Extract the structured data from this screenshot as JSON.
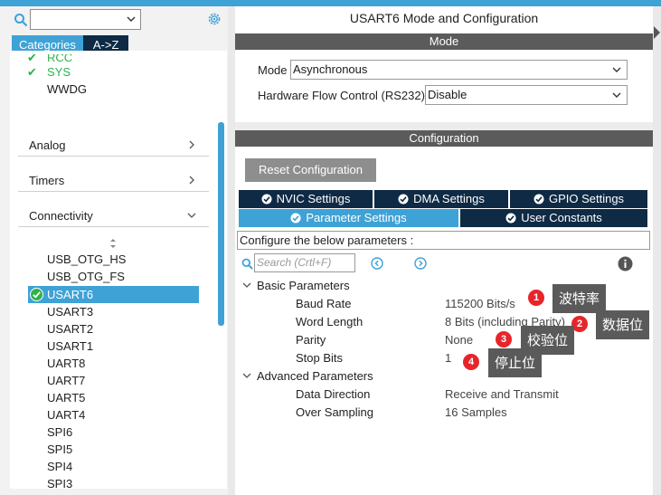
{
  "sidebar": {
    "tabs": [
      "Categories",
      "A->Z"
    ],
    "middleware_items": [
      {
        "label": "RCC",
        "checked": true
      },
      {
        "label": "SYS",
        "checked": true
      },
      {
        "label": "WWDG",
        "checked": false
      }
    ],
    "categories": [
      "Analog",
      "Timers",
      "Connectivity"
    ],
    "peripherals": [
      "USB_OTG_HS",
      "USB_OTG_FS",
      "USART6",
      "USART3",
      "USART2",
      "USART1",
      "UART8",
      "UART7",
      "UART5",
      "UART4",
      "SPI6",
      "SPI5",
      "SPI4",
      "SPI3"
    ],
    "selected_peripheral": "USART6"
  },
  "main": {
    "title": "USART6 Mode and Configuration",
    "mode_header": "Mode",
    "mode_label": "Mode",
    "mode_value": "Asynchronous",
    "flow_label": "Hardware Flow Control (RS232)",
    "flow_value": "Disable",
    "config_header": "Configuration",
    "reset_button": "Reset Configuration",
    "tabs_row1": [
      "NVIC Settings",
      "DMA Settings",
      "GPIO Settings"
    ],
    "tabs_row2": [
      "Parameter Settings",
      "User Constants"
    ],
    "configure_text": "Configure the below parameters :",
    "search_placeholder": "Search (Crtl+F)",
    "groups": [
      {
        "name": "Basic Parameters",
        "params": [
          {
            "name": "Baud Rate",
            "value": "115200 Bits/s"
          },
          {
            "name": "Word Length",
            "value": "8 Bits (including Parity)"
          },
          {
            "name": "Parity",
            "value": "None"
          },
          {
            "name": "Stop Bits",
            "value": "1"
          }
        ]
      },
      {
        "name": "Advanced Parameters",
        "params": [
          {
            "name": "Data Direction",
            "value": "Receive and Transmit"
          },
          {
            "name": "Over Sampling",
            "value": "16 Samples"
          }
        ]
      }
    ]
  },
  "annotations": [
    {
      "num": "1",
      "text": "波特率"
    },
    {
      "num": "2",
      "text": "数据位"
    },
    {
      "num": "3",
      "text": "校验位"
    },
    {
      "num": "4",
      "text": "停止位"
    }
  ],
  "colors": {
    "accent": "#3fa2d6",
    "navy": "#0e2a45",
    "check_green": "#2db34a",
    "badge_red": "#e8242b",
    "header_gray": "#5b5b5b"
  },
  "icons": [
    "search-icon",
    "gear-icon",
    "chevron-down-icon",
    "chevron-right-icon",
    "check-icon",
    "sort-icon",
    "info-icon",
    "nav-prev-icon",
    "nav-next-icon"
  ]
}
